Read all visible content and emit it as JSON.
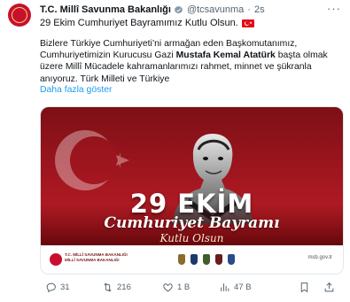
{
  "post": {
    "author_name": "T.C. Millî Savunma Bakanlığı",
    "handle": "@tcsavunma",
    "separator": "·",
    "time": "2s",
    "more_menu": "···",
    "headline": "29 Ekim Cumhuriyet Bayramımız Kutlu Olsun.",
    "body": {
      "line1": "Bizlere Türkiye Cumhuriyeti’ni armağan eden Başkomutanımız,",
      "line2_prefix": "Cumhuriyetimizin Kurucusu Gazi ",
      "line2_bold": "Mustafa Kemal Atatürk",
      "line2_suffix": " başta olmak",
      "line3": "üzere Millî Mücadele kahramanlarımızı rahmet, minnet ve şükranla",
      "line4": "anıyoruz. Türk Milleti ve Türkiye"
    },
    "show_more": "Daha fazla göster"
  },
  "media": {
    "title_number": "29 EKİM",
    "title_text": "Cumhuriyet Bayramı",
    "subtitle": "Kutlu Olsun",
    "ministry_line1": "T.C. MİLLÎ SAVUNMA BAKANLIĞI",
    "ministry_line2": "MİLLÎ SAVUNMA BAKANLIĞI",
    "site": "msb.gov.tr"
  },
  "actions": {
    "replies": "31",
    "reposts": "216",
    "likes": "1 B",
    "views": "47 B"
  },
  "colors": {
    "accent": "#1d9bf0",
    "verified_gray": "#829aab",
    "flag_red": "#e30a17"
  },
  "icons": [
    "verified-badge-icon",
    "turkish-flag-emoji",
    "reply-icon",
    "repost-icon",
    "like-icon",
    "views-icon",
    "bookmark-icon",
    "share-icon",
    "more-icon"
  ]
}
